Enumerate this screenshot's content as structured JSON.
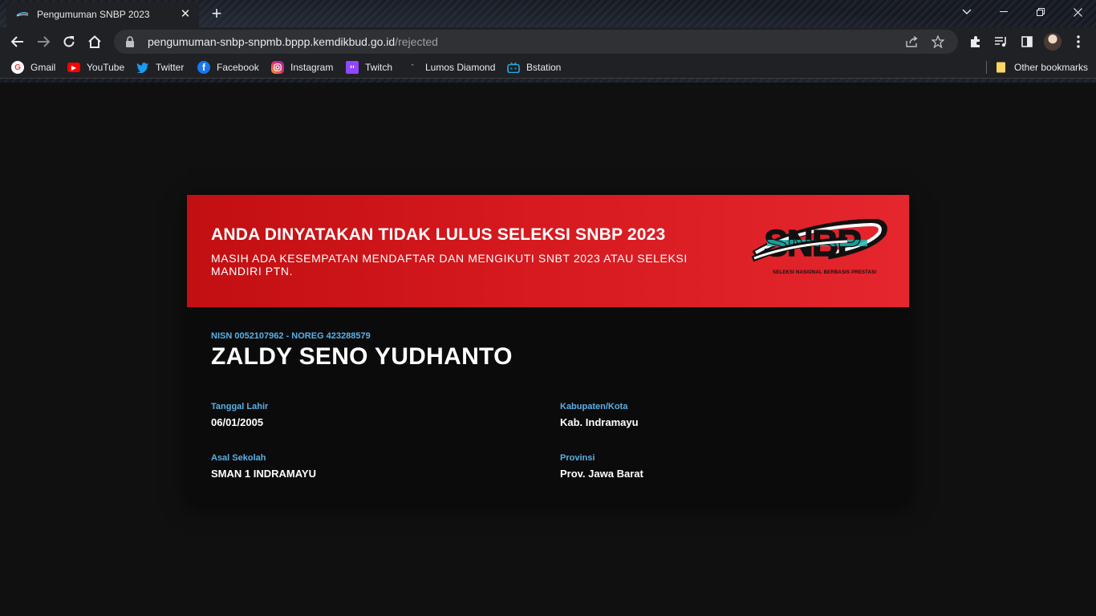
{
  "browser": {
    "tab_title": "Pengumuman SNBP 2023",
    "url_host": "pengumuman-snbp-snpmb.bppp.kemdikbud.go.id",
    "url_path": "/rejected",
    "bookmarks": [
      {
        "label": "Gmail",
        "icon": "gmail-icon",
        "color": "#ea4335"
      },
      {
        "label": "YouTube",
        "icon": "youtube-icon",
        "color": "#ff0000"
      },
      {
        "label": "Twitter",
        "icon": "twitter-icon",
        "color": "#1d9bf0"
      },
      {
        "label": "Facebook",
        "icon": "facebook-icon",
        "color": "#1877f2"
      },
      {
        "label": "Instagram",
        "icon": "instagram-icon",
        "color": "#e1306c"
      },
      {
        "label": "Twitch",
        "icon": "twitch-icon",
        "color": "#9146ff"
      },
      {
        "label": "Lumos Diamond",
        "icon": "lumos-icon",
        "color": "#9aa0a6"
      },
      {
        "label": "Bstation",
        "icon": "bstation-icon",
        "color": "#23ade5"
      }
    ],
    "other_bookmarks": "Other bookmarks"
  },
  "result": {
    "headline": "ANDA DINYATAKAN TIDAK LULUS SELEKSI SNBP 2023",
    "subtext": "MASIH ADA KESEMPATAN MENDAFTAR DAN MENGIKUTI SNBT 2023 ATAU SELEKSI MANDIRI PTN.",
    "logo_text": "SNBP",
    "logo_subtitle": "SELEKSI NASIONAL BERBASIS PRESTASI",
    "banner_color": "#d5191e"
  },
  "student": {
    "id_line": "NISN 0052107962 - NOREG 423288579",
    "name": "ZALDY SENO YUDHANTO",
    "birth_label": "Tanggal Lahir",
    "birth_value": "06/01/2005",
    "city_label": "Kabupaten/Kota",
    "city_value": "Kab. Indramayu",
    "school_label": "Asal Sekolah",
    "school_value": "SMAN 1 INDRAMAYU",
    "province_label": "Provinsi",
    "province_value": "Prov. Jawa Barat",
    "label_color": "#5ab0e6"
  }
}
